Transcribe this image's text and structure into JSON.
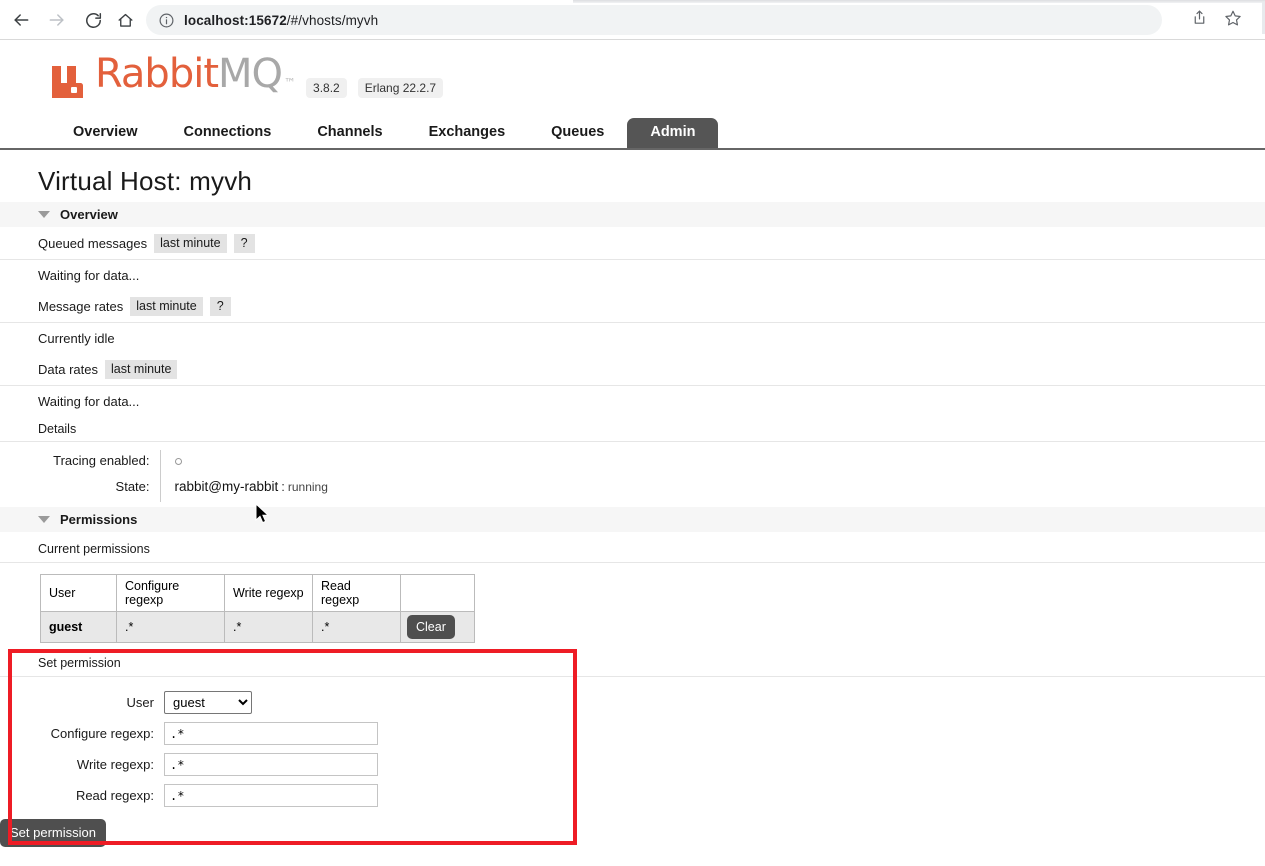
{
  "browser": {
    "url_prefix": "localhost:15672",
    "url_suffix": "/#/vhosts/myvh",
    "back_icon": "back-arrow-icon",
    "forward_icon": "forward-arrow-icon",
    "reload_icon": "reload-icon",
    "home_icon": "home-icon",
    "site_info_icon": "info-circle-icon",
    "share_icon": "share-icon",
    "bookmark_icon": "star-icon"
  },
  "header": {
    "logo_rabbit": "Rabbit",
    "logo_mq": "MQ",
    "logo_tm": "™",
    "version": "3.8.2",
    "erlang_version": "Erlang 22.2.7"
  },
  "nav": {
    "tabs": [
      {
        "label": "Overview",
        "active": false
      },
      {
        "label": "Connections",
        "active": false
      },
      {
        "label": "Channels",
        "active": false
      },
      {
        "label": "Exchanges",
        "active": false
      },
      {
        "label": "Queues",
        "active": false
      },
      {
        "label": "Admin",
        "active": true
      }
    ]
  },
  "page": {
    "title": "Virtual Host: myvh"
  },
  "overview": {
    "section_label": "Overview",
    "queued_messages": {
      "label": "Queued messages",
      "period_chip": "last minute",
      "help_chip": "?",
      "body": "Waiting for data..."
    },
    "message_rates": {
      "label": "Message rates",
      "period_chip": "last minute",
      "help_chip": "?",
      "body": "Currently idle"
    },
    "data_rates": {
      "label": "Data rates",
      "period_chip": "last minute",
      "body": "Waiting for data..."
    },
    "details": {
      "label": "Details",
      "tracing_label": "Tracing enabled:",
      "tracing_value": "",
      "state_label": "State:",
      "state_node": "rabbit@my-rabbit",
      "state_separator": ":",
      "state_value": "running"
    }
  },
  "permissions": {
    "section_label": "Permissions",
    "current_label": "Current permissions",
    "columns": [
      "User",
      "Configure regexp",
      "Write regexp",
      "Read regexp",
      ""
    ],
    "rows": [
      {
        "user": "guest",
        "configure": ".*",
        "write": ".*",
        "read": ".*",
        "action_label": "Clear"
      }
    ],
    "set_permission": {
      "label": "Set permission",
      "user_label": "User",
      "user_value": "guest",
      "user_options": [
        "guest"
      ],
      "configure_label": "Configure regexp:",
      "configure_value": ".*",
      "write_label": "Write regexp:",
      "write_value": ".*",
      "read_label": "Read regexp:",
      "read_value": ".*",
      "submit_label": "Set permission"
    }
  },
  "annotation": {
    "color": "#ee1c25"
  }
}
